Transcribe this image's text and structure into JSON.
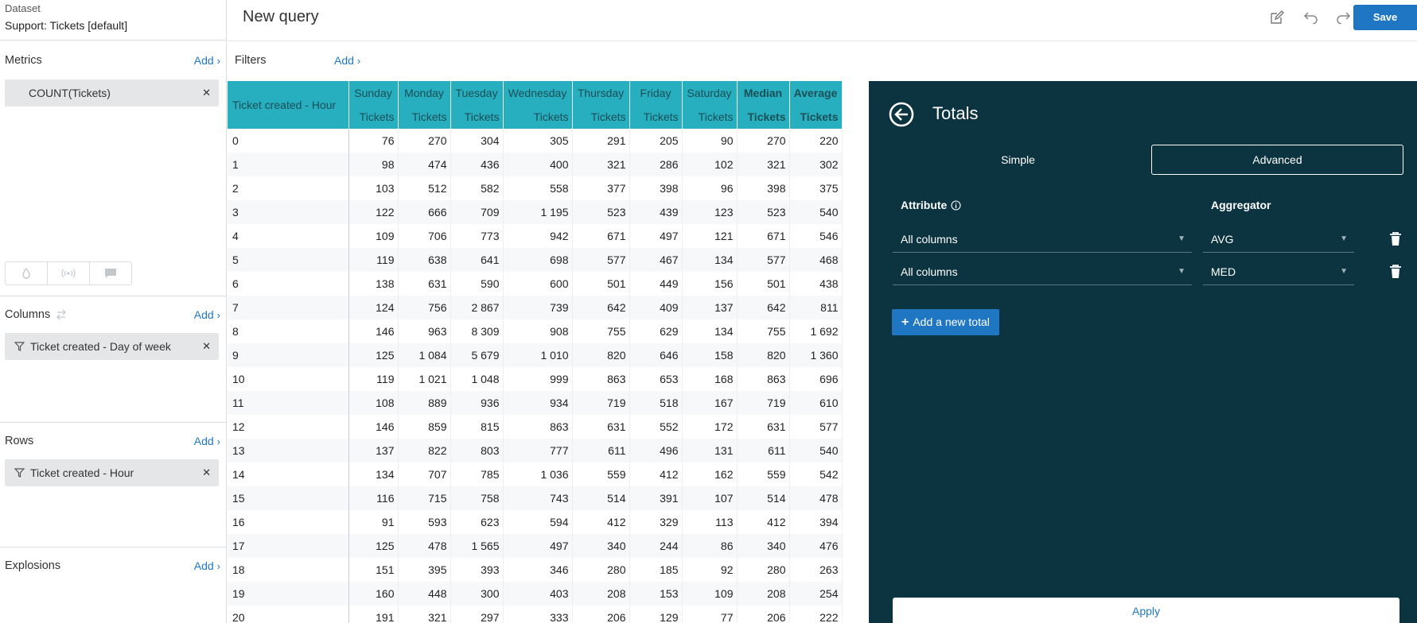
{
  "dataset": {
    "label": "Dataset",
    "value": "Support: Tickets [default]"
  },
  "sidebar": {
    "metrics": {
      "title": "Metrics",
      "add": "Add",
      "items": [
        {
          "label": "COUNT(Tickets)"
        }
      ]
    },
    "columns": {
      "title": "Columns",
      "add": "Add",
      "items": [
        {
          "label": "Ticket created - Day of week"
        }
      ]
    },
    "rows": {
      "title": "Rows",
      "add": "Add",
      "items": [
        {
          "label": "Ticket created - Hour"
        }
      ]
    },
    "explosions": {
      "title": "Explosions",
      "add": "Add"
    }
  },
  "topbar": {
    "title": "New query",
    "save_label": "Save"
  },
  "filters": {
    "label": "Filters",
    "add": "Add"
  },
  "table": {
    "row_header": "Ticket created - Hour",
    "columns": [
      {
        "top": "Sunday",
        "bottom": "Tickets",
        "bold": false
      },
      {
        "top": "Monday",
        "bottom": "Tickets",
        "bold": false
      },
      {
        "top": "Tuesday",
        "bottom": "Tickets",
        "bold": false
      },
      {
        "top": "Wednesday",
        "bottom": "Tickets",
        "bold": false
      },
      {
        "top": "Thursday",
        "bottom": "Tickets",
        "bold": false
      },
      {
        "top": "Friday",
        "bottom": "Tickets",
        "bold": false
      },
      {
        "top": "Saturday",
        "bottom": "Tickets",
        "bold": false
      },
      {
        "top": "Median",
        "bottom": "Tickets",
        "bold": true
      },
      {
        "top": "Average",
        "bottom": "Tickets",
        "bold": true
      }
    ],
    "rows": [
      [
        "0",
        "76",
        "270",
        "304",
        "305",
        "291",
        "205",
        "90",
        "270",
        "220"
      ],
      [
        "1",
        "98",
        "474",
        "436",
        "400",
        "321",
        "286",
        "102",
        "321",
        "302"
      ],
      [
        "2",
        "103",
        "512",
        "582",
        "558",
        "377",
        "398",
        "96",
        "398",
        "375"
      ],
      [
        "3",
        "122",
        "666",
        "709",
        "1 195",
        "523",
        "439",
        "123",
        "523",
        "540"
      ],
      [
        "4",
        "109",
        "706",
        "773",
        "942",
        "671",
        "497",
        "121",
        "671",
        "546"
      ],
      [
        "5",
        "119",
        "638",
        "641",
        "698",
        "577",
        "467",
        "134",
        "577",
        "468"
      ],
      [
        "6",
        "138",
        "631",
        "590",
        "600",
        "501",
        "449",
        "156",
        "501",
        "438"
      ],
      [
        "7",
        "124",
        "756",
        "2 867",
        "739",
        "642",
        "409",
        "137",
        "642",
        "811"
      ],
      [
        "8",
        "146",
        "963",
        "8 309",
        "908",
        "755",
        "629",
        "134",
        "755",
        "1 692"
      ],
      [
        "9",
        "125",
        "1 084",
        "5 679",
        "1 010",
        "820",
        "646",
        "158",
        "820",
        "1 360"
      ],
      [
        "10",
        "119",
        "1 021",
        "1 048",
        "999",
        "863",
        "653",
        "168",
        "863",
        "696"
      ],
      [
        "11",
        "108",
        "889",
        "936",
        "934",
        "719",
        "518",
        "167",
        "719",
        "610"
      ],
      [
        "12",
        "146",
        "859",
        "815",
        "863",
        "631",
        "552",
        "172",
        "631",
        "577"
      ],
      [
        "13",
        "137",
        "822",
        "803",
        "777",
        "611",
        "496",
        "131",
        "611",
        "540"
      ],
      [
        "14",
        "134",
        "707",
        "785",
        "1 036",
        "559",
        "412",
        "162",
        "559",
        "542"
      ],
      [
        "15",
        "116",
        "715",
        "758",
        "743",
        "514",
        "391",
        "107",
        "514",
        "478"
      ],
      [
        "16",
        "91",
        "593",
        "623",
        "594",
        "412",
        "329",
        "113",
        "412",
        "394"
      ],
      [
        "17",
        "125",
        "478",
        "1 565",
        "497",
        "340",
        "244",
        "86",
        "340",
        "476"
      ],
      [
        "18",
        "151",
        "395",
        "393",
        "346",
        "280",
        "185",
        "92",
        "280",
        "263"
      ],
      [
        "19",
        "160",
        "448",
        "300",
        "403",
        "208",
        "153",
        "109",
        "208",
        "254"
      ],
      [
        "20",
        "191",
        "321",
        "297",
        "333",
        "206",
        "129",
        "77",
        "206",
        "222"
      ]
    ]
  },
  "panel": {
    "title": "Totals",
    "tabs": {
      "simple": "Simple",
      "advanced": "Advanced"
    },
    "attribute_header": "Attribute",
    "aggregator_header": "Aggregator",
    "totals": [
      {
        "attribute": "All columns",
        "aggregator": "AVG"
      },
      {
        "attribute": "All columns",
        "aggregator": "MED"
      }
    ],
    "add_total": "Add a new total",
    "apply": "Apply"
  },
  "colors": {
    "accent": "#1f77c4",
    "header": "#27aebf",
    "panel_bg": "#0b3440"
  }
}
